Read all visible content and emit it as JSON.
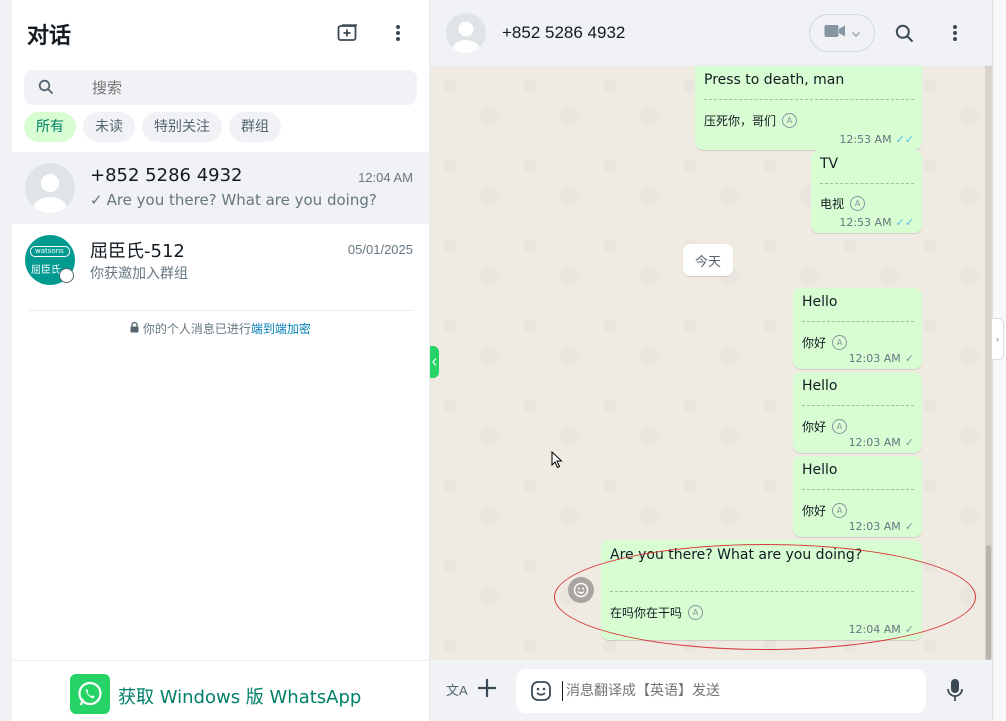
{
  "sidebar": {
    "title": "对话",
    "search_placeholder": "搜索",
    "filters": [
      "所有",
      "未读",
      "特别关注",
      "群组"
    ],
    "chats": [
      {
        "name": "+852 5286 4932",
        "time": "12:04 AM",
        "preview": "Are you there? What are you doing?",
        "tick": "✓"
      },
      {
        "name": "屈臣氏-512",
        "time": "05/01/2025",
        "preview": "你获邀加入群组",
        "avatar_text": "屈臣氏",
        "avatar_brand": "watsons"
      }
    ],
    "e2e_prefix": "你的个人消息已进行",
    "e2e_link": "端到端加密",
    "get_windows": "获取 Windows 版 WhatsApp"
  },
  "conversation": {
    "contact": "+852 5286 4932",
    "date_pill": "今天",
    "messages": [
      {
        "text": "Press to death, man",
        "translation": "压死你，哥们",
        "time": "12:53 AM",
        "ticks": "✓✓",
        "tick_color": "blue"
      },
      {
        "text": "TV",
        "translation": "电视",
        "time": "12:53 AM",
        "ticks": "✓✓",
        "tick_color": "blue"
      },
      {
        "text": "Hello",
        "translation": "你好",
        "time": "12:03 AM",
        "ticks": "✓",
        "tick_color": "grey"
      },
      {
        "text": "Hello",
        "translation": "你好",
        "time": "12:03 AM",
        "ticks": "✓",
        "tick_color": "grey"
      },
      {
        "text": "Hello",
        "translation": "你好",
        "time": "12:03 AM",
        "ticks": "✓",
        "tick_color": "grey"
      },
      {
        "text": "Are you there? What are you doing?",
        "translation": "在吗你在干吗",
        "time": "12:04 AM",
        "ticks": "✓",
        "tick_color": "grey"
      }
    ]
  },
  "composer": {
    "placeholder": "消息翻译成【英语】发送",
    "translate_icon": "文A"
  },
  "colors": {
    "accent": "#008069",
    "bubble_out": "#d9fdd3",
    "chat_bg": "#efeae2",
    "annotation": "#d63a3a"
  }
}
